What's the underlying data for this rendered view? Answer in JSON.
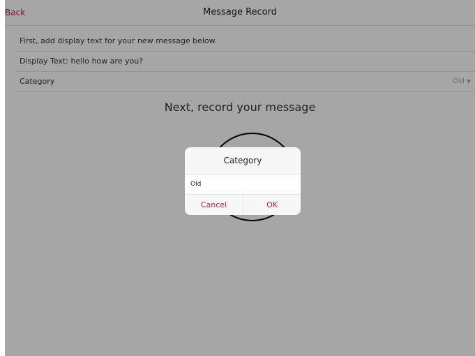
{
  "navbar": {
    "back_label": "Back",
    "title": "Message Record"
  },
  "form": {
    "instruction": "First, add display text for your new message below.",
    "display_text": "Display Text: hello how are you?",
    "category_label": "Category",
    "category_value": "Old"
  },
  "record": {
    "heading": "Next, record your message"
  },
  "dialog": {
    "title": "Category",
    "input_value": "Old",
    "cancel_label": "Cancel",
    "ok_label": "OK"
  },
  "colors": {
    "accent": "#c2185b"
  }
}
